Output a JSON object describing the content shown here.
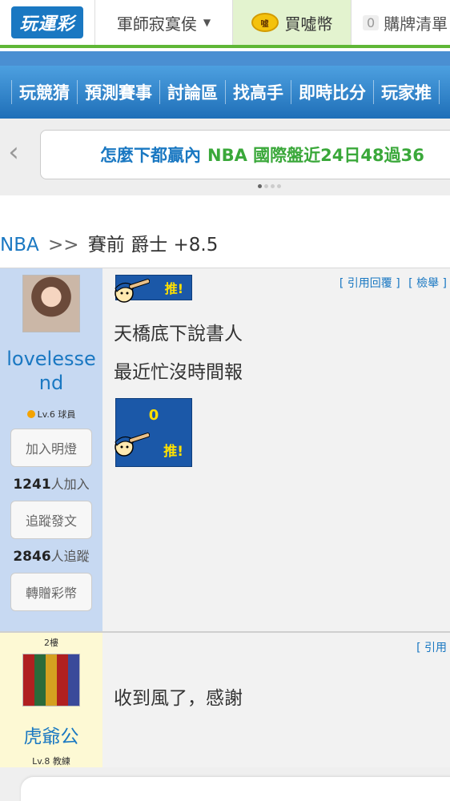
{
  "header": {
    "logo_text": "玩運彩",
    "user_name": "軍師寂寞侯",
    "coin_icon_text": "噓",
    "buy_coin_label": "買噓幣",
    "cart_count": "0",
    "cart_label": "購牌清單"
  },
  "nav": {
    "items": [
      "玩競猜",
      "預測賽事",
      "討論區",
      "找高手",
      "即時比分",
      "玩家推"
    ]
  },
  "ticker": {
    "text": "怎麼下都贏內",
    "highlight": "NBA 國際盤近24日48過36"
  },
  "breadcrumb": {
    "league": "NBA",
    "separator": ">>",
    "title": "賽前 爵士 +8.5"
  },
  "post1": {
    "username": "lovelessend",
    "level": "Lv.6 球員",
    "push_label": "推!",
    "quote_reply": "[ 引用回覆 ]",
    "report": "[ 檢舉 ]",
    "line1": "天橋底下說書人",
    "line2": "最近忙沒時間報",
    "push_count": "0",
    "follow_light_btn": "加入明燈",
    "light_count": "1241",
    "light_suffix": "人加入",
    "track_btn": "追蹤發文",
    "track_count": "2846",
    "track_suffix": "人追蹤",
    "gift_btn": "轉贈彩幣"
  },
  "post2": {
    "floor": "2樓",
    "username": "虎爺公",
    "level": "Lv.8 教練",
    "quote_reply": "[ 引用",
    "text": "收到風了，感謝"
  }
}
